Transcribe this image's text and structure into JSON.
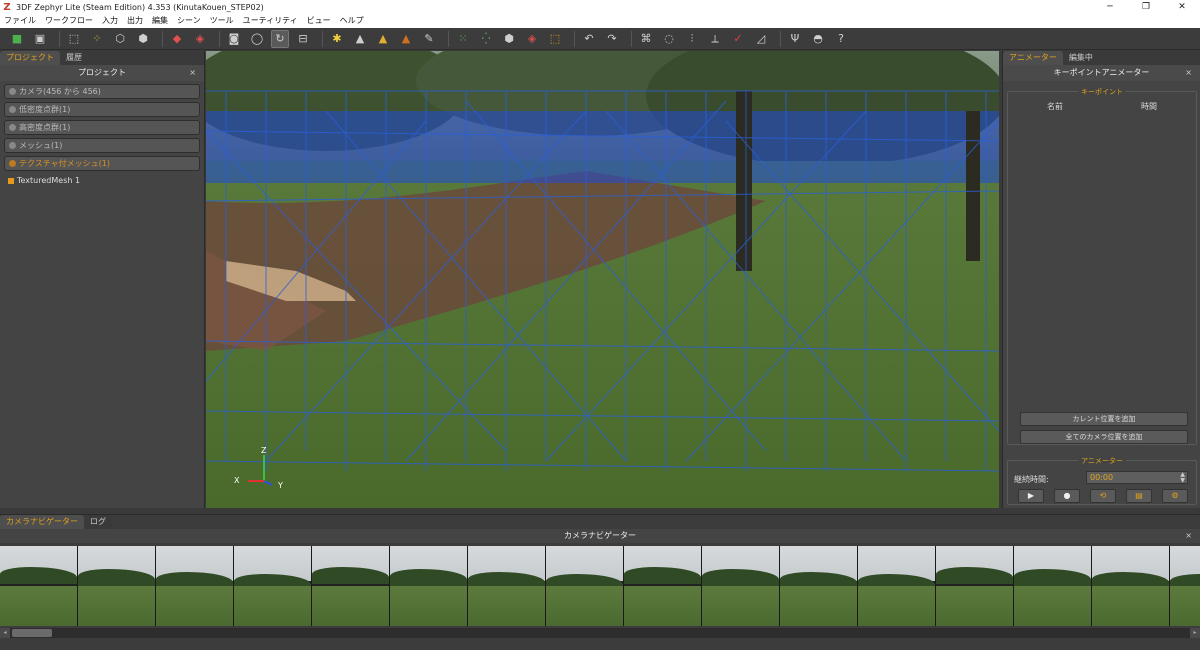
{
  "window": {
    "logo": "Z",
    "title": "3DF Zephyr Lite (Steam Edition) 4.353 (KinutaKouen_STEP02)",
    "minimize": "─",
    "maximize": "❐",
    "close": "✕"
  },
  "menu": [
    "ファイル",
    "ワークフロー",
    "入力",
    "出力",
    "編集",
    "シーン",
    "ツール",
    "ユーティリティ",
    "ビュー",
    "ヘルプ"
  ],
  "toolbar": {
    "icons": [
      "new-project-icon",
      "save-icon",
      "select-rect-icon",
      "points-icon",
      "cube-icon",
      "cube-wire-icon",
      "mesh-icon",
      "textured-mesh-icon",
      "camera-icon",
      "orbit-icon",
      "rotate-icon",
      "fit-icon",
      "light-icon",
      "triangle-icon",
      "triangle-color-icon",
      "triangle-texture-icon",
      "brush-icon",
      "point-cloud-icon",
      "dense-cloud-icon",
      "mesh-view-icon",
      "texture-view-icon",
      "bbox-icon",
      "undo-icon",
      "redo-icon",
      "select-lasso-icon",
      "circle-select-icon",
      "pick-icon",
      "measure-icon",
      "axes-icon",
      "ruler-icon",
      "tool-icon",
      "vr-icon",
      "help-icon"
    ],
    "help": "?"
  },
  "left_panel": {
    "tabs": [
      "プロジェクト",
      "履歴"
    ],
    "title": "プロジェクト",
    "close": "×",
    "rows": [
      {
        "label": "カメラ(456 から 456)"
      },
      {
        "label": "低密度点群(1)"
      },
      {
        "label": "高密度点群(1)"
      },
      {
        "label": "メッシュ(1)"
      },
      {
        "label": "テクスチャ付メッシュ(1)"
      }
    ],
    "leaf": "TexturedMesh 1"
  },
  "viewport": {
    "axis_z": "Z",
    "axis_x": "X",
    "axis_y": "Y",
    "colors": {
      "wire": "#2a5fd8",
      "grass": "#4f6e33",
      "path": "#6a4a3a",
      "tree": "#2c3b22"
    }
  },
  "right_panel": {
    "tabs": [
      "アニメーター",
      "編集中"
    ],
    "title": "キーポイントアニメーター",
    "close": "×",
    "keypoint_group": "キーポイント",
    "col_name": "名前",
    "col_time": "時間",
    "add_current": "カレント位置を追加",
    "add_all_cameras": "全てのカメラ位置を追加",
    "animator_group": "アニメーター",
    "duration_label": "継続時間:",
    "duration_value": "00:00",
    "controls": [
      "▶",
      "●",
      "⟲",
      "▤",
      "⚙"
    ]
  },
  "bottom": {
    "tabs": [
      "カメラナビゲーター",
      "ログ"
    ],
    "title": "カメラナビゲーター",
    "close": "×",
    "thumb_count": 16,
    "scroll_left": "◂",
    "scroll_right": "▸"
  }
}
